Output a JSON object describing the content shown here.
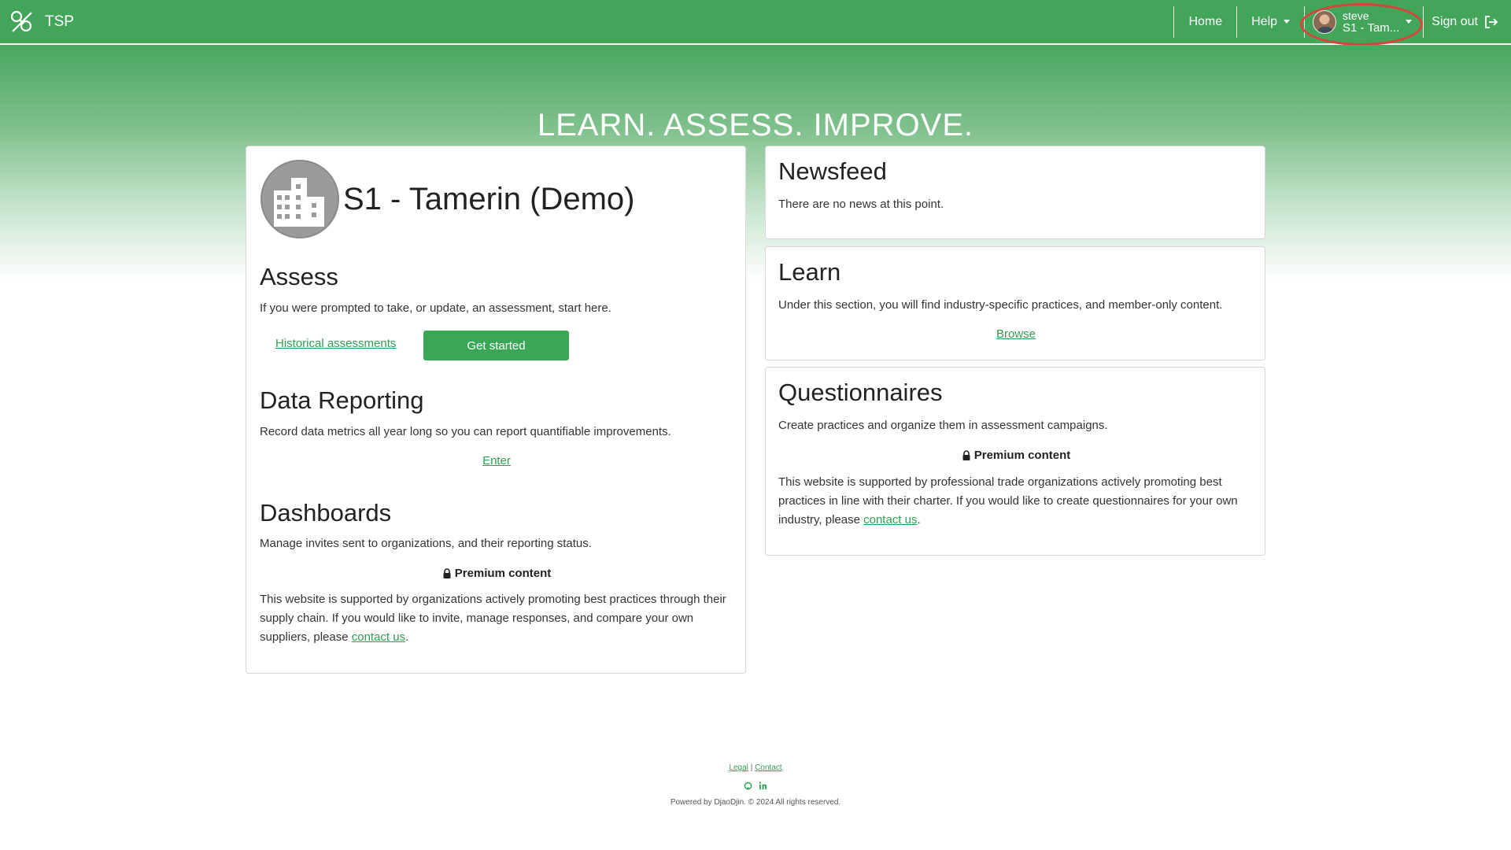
{
  "nav": {
    "brand": "TSP",
    "home": "Home",
    "help": "Help",
    "user_name": "steve",
    "user_org": "S1 - Tam...",
    "signout": "Sign out"
  },
  "hero": {
    "title": "LEARN. ASSESS. IMPROVE."
  },
  "org": {
    "name": "S1 - Tamerin (Demo)"
  },
  "assess": {
    "title": "Assess",
    "text": "If you were prompted to take, or update, an assessment, start here.",
    "historical_link": "Historical assessments",
    "get_started": "Get started"
  },
  "data_reporting": {
    "title": "Data Reporting",
    "text": "Record data metrics all year long so you can report quantifiable improvements.",
    "enter_link": "Enter"
  },
  "dashboards": {
    "title": "Dashboards",
    "text": "Manage invites sent to organizations, and their reporting status.",
    "premium": "Premium content",
    "premium_text": "This website is supported by organizations actively promoting best practices through their supply chain. If you would like to invite, manage responses, and compare your own suppliers, please ",
    "contact_link": "contact us",
    "premium_end": "."
  },
  "newsfeed": {
    "title": "Newsfeed",
    "text": "There are no news at this point."
  },
  "learn": {
    "title": "Learn",
    "text": "Under this section, you will find industry-specific practices, and member-only content.",
    "browse_link": "Browse"
  },
  "questionnaires": {
    "title": "Questionnaires",
    "text": "Create practices and organize them in assessment campaigns.",
    "premium": "Premium content",
    "premium_text": "This website is supported by professional trade organizations actively promoting best practices in line with their charter. If you would like to create questionnaires for your own industry, please ",
    "contact_link": "contact us",
    "premium_end": "."
  },
  "footer": {
    "legal": "Legal",
    "separator": "|",
    "contact": "Contact",
    "powered": "Powered by DjaoDjin. © 2024 All rights reserved."
  },
  "colors": {
    "nav_green": "#43a55a",
    "button_green": "#3aa757",
    "link_green": "#2e9e52",
    "highlight_red": "#d9433b"
  }
}
